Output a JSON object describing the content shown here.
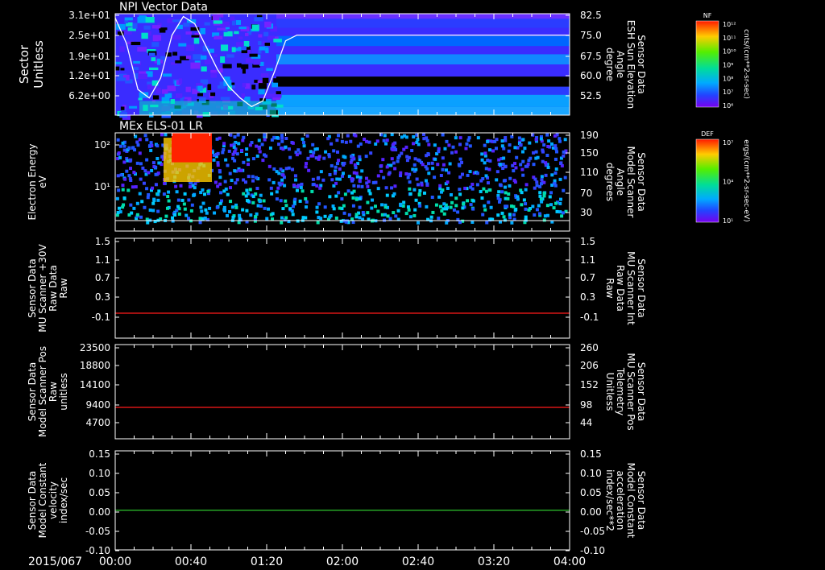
{
  "colors": {
    "white": "#ffffff",
    "red": "#ff1a1a",
    "green": "#33dd33",
    "background": "#000000"
  },
  "time_axis": {
    "date_label": "2015/067",
    "tick_labels": [
      "00:00",
      "00:40",
      "01:20",
      "02:00",
      "02:40",
      "03:20",
      "04:00"
    ]
  },
  "colorbars": [
    {
      "title": "NF",
      "unit_label": "cnts/(cm**2-sr-sec)",
      "tick_labels": [
        "10¹²",
        "10¹¹",
        "10¹⁰",
        "10⁹",
        "10⁸",
        "10⁷",
        "10⁶"
      ]
    },
    {
      "title": "DEF",
      "unit_label": "ergs/(cm**2-sr-sec-eV)",
      "tick_labels": [
        "10⁷",
        "10⁴",
        "10¹"
      ]
    }
  ],
  "chart_data": [
    {
      "type": "heatmap",
      "title": "NPI Vector Data",
      "ylabel_lines": [
        "Sector",
        "Unitless"
      ],
      "y_tick_labels": [
        "3.1e+01",
        "2.5e+01",
        "1.9e+01",
        "1.2e+01",
        "6.2e+00"
      ],
      "ylim": [
        0,
        31
      ],
      "right_axis": {
        "label_lines": [
          "Sensor Data",
          "ESH Sun Elevation",
          "Angle",
          "degree"
        ],
        "tick_labels": [
          "82.5",
          "75.0",
          "67.5",
          "60.0",
          "52.5"
        ],
        "ylim": [
          47,
          82.5
        ]
      },
      "x_range_hours": [
        0,
        4
      ],
      "overlay_series": {
        "axis": "right",
        "x_hours": [
          0.0,
          0.1,
          0.2,
          0.3,
          0.4,
          0.5,
          0.6,
          0.7,
          0.8,
          0.9,
          1.0,
          1.1,
          1.2,
          1.3,
          1.4,
          1.5,
          1.6,
          4.0
        ],
        "values": [
          81.0,
          72.0,
          56.0,
          53.0,
          60.0,
          75.0,
          81.5,
          79.0,
          71.0,
          63.0,
          57.0,
          53.0,
          50.0,
          52.0,
          62.0,
          73.0,
          75.0,
          75.0
        ]
      }
    },
    {
      "type": "heatmap",
      "title": "MEx ELS-01 LR",
      "ylabel_lines": [
        "Electron Energy",
        "eV"
      ],
      "y_tick_labels": [
        "10²",
        "10¹"
      ],
      "y_scale": "log",
      "right_axis": {
        "label_lines": [
          "Sensor Data",
          "Model Scanner",
          "Angle",
          "degrees"
        ],
        "tick_labels": [
          "190",
          "150",
          "110",
          "70",
          "30"
        ],
        "ylim": [
          10,
          190
        ]
      },
      "x_range_hours": [
        0,
        4
      ]
    },
    {
      "type": "line",
      "ylabel_lines": [
        "Sensor Data",
        "MU Scanner +30V",
        "Raw Data",
        "Raw"
      ],
      "y_tick_labels": [
        "1.5",
        "1.1",
        "0.7",
        "0.3",
        "-0.1"
      ],
      "ylim": [
        -0.5,
        1.5
      ],
      "right_axis": {
        "label_lines": [
          "Sensor Data",
          "MU Scanner Int",
          "Raw Data",
          "Raw"
        ],
        "tick_labels": [
          "1.5",
          "1.1",
          "0.7",
          "0.3",
          "-0.1"
        ],
        "ylim": [
          -0.5,
          1.5
        ],
        "color": "#ff1a1a"
      },
      "series": [
        {
          "axis": "right",
          "color": "#ff1a1a",
          "x_hours": [
            0,
            4
          ],
          "values": [
            0.0,
            0.0
          ]
        }
      ]
    },
    {
      "type": "line",
      "ylabel_lines": [
        "Sensor Data",
        "Model Scanner Pos",
        "Raw",
        "unitless"
      ],
      "y_tick_labels": [
        "23500",
        "18800",
        "14100",
        "9400",
        "4700"
      ],
      "ylim": [
        0,
        23500
      ],
      "right_axis": {
        "label_lines": [
          "Sensor Data",
          "MU Scanner Pos",
          "Telemetry",
          "Unitless"
        ],
        "tick_labels": [
          "260",
          "206",
          "152",
          "98",
          "44"
        ],
        "ylim": [
          -10,
          260
        ],
        "color": "#ff1a1a"
      },
      "series": [
        {
          "axis": "right",
          "color": "#ff1a1a",
          "x_hours": [
            0,
            4
          ],
          "values": [
            80,
            80
          ]
        }
      ]
    },
    {
      "type": "line",
      "ylabel_lines": [
        "Sensor Data",
        "Model Constant",
        "velocity",
        "index/sec"
      ],
      "y_tick_labels": [
        "0.15",
        "0.10",
        "0.05",
        "0.00",
        "-0.05",
        "-0.10"
      ],
      "ylim": [
        -0.1,
        0.15
      ],
      "right_axis": {
        "label_lines": [
          "Sensor Data",
          "Model Constant",
          "acceleration",
          "index/sec**2"
        ],
        "tick_labels": [
          "0.15",
          "0.10",
          "0.05",
          "0.00",
          "-0.05",
          "-0.10"
        ],
        "ylim": [
          -0.1,
          0.15
        ],
        "color": "#33dd33"
      },
      "series": [
        {
          "axis": "right",
          "color": "#33dd33",
          "x_hours": [
            0,
            4
          ],
          "values": [
            0.0,
            0.0
          ]
        }
      ]
    }
  ]
}
